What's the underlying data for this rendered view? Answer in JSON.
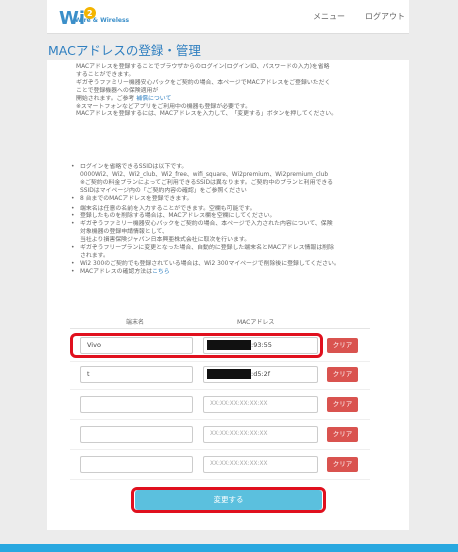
{
  "header": {
    "logo_sub": "Wire & Wireless",
    "nav": [
      "メニュー",
      "ログアウト"
    ]
  },
  "page_title": "MACアドレスの登録・管理",
  "intro": {
    "p1_lines": [
      "MACアドレスを登録することでブラウザからのログイン(ログインID、パスワードの入力)を省略",
      "することができます。",
      "ギガぞうファミリー機器安心パックをご契約の場合、本ページでMACアドレスをご登録いただく",
      "ことで登録機器への保険適用が"
    ],
    "p1_link_prefix": "開始されます。ご参考 ",
    "p1_link": "補償について",
    "p2_lines": [
      "※スマートフォンなどアプリをご利用中の機器も登録が必要です。",
      "MACアドレスを登録するには、MACアドレスを入力して、「変更する」ボタンを押してください。"
    ]
  },
  "notes": [
    {
      "lines": [
        "ログインを省略できるSSIDは以下です。",
        "0000Wi2、Wi2、Wi2_club、Wi2_free、wifi_square、Wi2premium、Wi2premium_club",
        "※ご契約の料金プランによってご利用できるSSIDは異なります。ご契約中のプランと利用できる",
        "SSIDはマイページ内の「ご契約内容の確認」をご参照ください"
      ]
    },
    {
      "lines": [
        "8 台までのMACアドレスを登録できます。"
      ]
    },
    {
      "lines": [
        "端末名は任意の名前を入力することができます。空欄も可能です。"
      ],
      "gap": true
    },
    {
      "lines": [
        "登録したものを削除する場合は、MACアドレス欄を空欄にしてください。"
      ]
    },
    {
      "lines": [
        "ギガぞうファミリー機器安心パックをご契約の場合、本ページで入力された内容について、保険",
        "対象機器の登録申請情報として、",
        "当社より損害保険ジャパン日本興亜株式会社に取次を行います。"
      ]
    },
    {
      "lines": [
        "ギガぞうフリープランに変更となった場合、自動的に登録した端末名とMACアドレス情報は削除",
        "されます。"
      ]
    },
    {
      "lines": [
        "Wi2 300のご契約でも登録されている場合は、Wi2 300マイページで削除後に登録してください。"
      ]
    },
    {
      "lines_prefix": "MACアドレスの確認方法は",
      "link": "こちら"
    }
  ],
  "table": {
    "col_name": "端末名",
    "col_mac": "MACアドレス",
    "mac_placeholder": "XX:XX:XX:XX:XX:XX",
    "clear_label": "クリア",
    "rows": [
      {
        "name": "Vivo",
        "mac_suffix": ":93:55",
        "redacted": true
      },
      {
        "name": "t",
        "mac_suffix": ":d5:2f",
        "redacted": true
      },
      {
        "name": "",
        "mac_suffix": "",
        "redacted": false
      },
      {
        "name": "",
        "mac_suffix": "",
        "redacted": false
      },
      {
        "name": "",
        "mac_suffix": "",
        "redacted": false
      }
    ]
  },
  "submit_label": "変更する",
  "colors": {
    "accent": "#2f7fc0",
    "clear_button": "#d9534f",
    "submit_button": "#5bc0de",
    "highlight": "#e0101e"
  }
}
